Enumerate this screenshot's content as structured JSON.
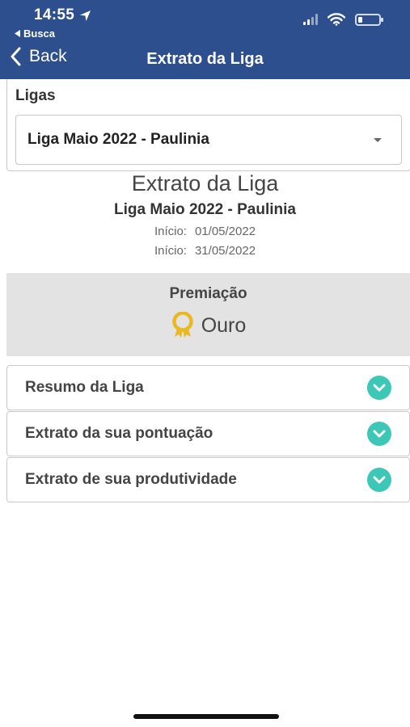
{
  "status_bar": {
    "time": "14:55",
    "back_app": "Busca",
    "battery_level": 0.2
  },
  "nav": {
    "back_label": "Back",
    "title": "Extrato da Liga"
  },
  "ligas": {
    "label": "Ligas",
    "selected": "Liga Maio 2022 - Paulinia"
  },
  "summary": {
    "title": "Extrato da Liga",
    "league_name": "Liga Maio 2022 - Paulinia",
    "start_label": "Início:",
    "start_date": "01/05/2022",
    "end_label": "Início:",
    "end_date": "31/05/2022"
  },
  "prize": {
    "title": "Premiação",
    "value": "Ouro",
    "icon": "medal-icon",
    "icon_color": "#e8b923"
  },
  "sections": [
    {
      "label": "Resumo da Liga"
    },
    {
      "label": "Extrato da sua pontuação"
    },
    {
      "label": "Extrato de sua produtividade"
    }
  ],
  "colors": {
    "header": "#2d4f8e",
    "accent": "#3cc7b6",
    "prize_bg": "#e3e3e3"
  }
}
